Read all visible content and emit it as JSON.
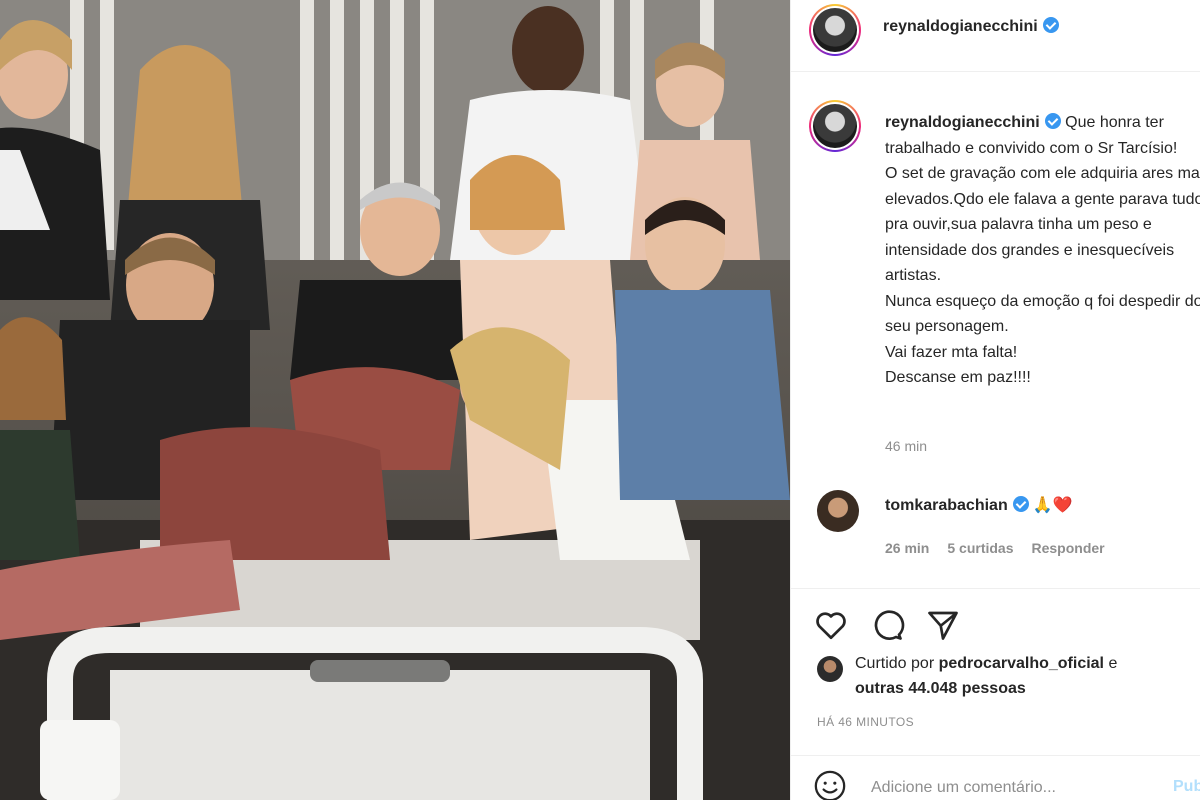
{
  "photo": {
    "description_icon": "group-photo"
  },
  "header": {
    "username": "reynaldogianecchini",
    "verified_icon": "verified-badge-icon"
  },
  "caption": {
    "username": "reynaldogianecchini",
    "text": "Que honra ter\ntrabalhado e convivido com o Sr Tarcísio!\nO set de gravação com ele adquiria ares mais elevados.Qdo ele falava a gente parava tudo pra ouvir,sua palavra tinha um peso e intensidade dos grandes e inesquecíveis artistas.\nNunca esqueço da emoção q foi despedir do seu personagem.\nVai fazer mta falta!\nDescanse em paz!!!!",
    "time": "46 min"
  },
  "comment": {
    "username": "tomkarabachian",
    "emojis": "🙏❤️",
    "time": "26 min",
    "likes": "5 curtidas",
    "reply": "Responder"
  },
  "likes": {
    "prefix": "Curtido por",
    "user": "pedrocarvalho_oficial",
    "conj": "e",
    "others": "outras 44.048 pessoas"
  },
  "posted": "HÁ 46 MINUTOS",
  "add_comment": {
    "placeholder": "Adicione um comentário...",
    "publish": "Publicar"
  },
  "colors": {
    "verified": "#3897f0",
    "muted": "#8e8e8e",
    "publish_disabled": "#b2dffc"
  }
}
